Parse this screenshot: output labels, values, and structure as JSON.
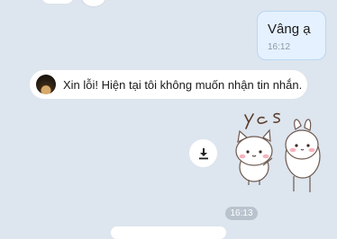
{
  "outgoing": {
    "text": "Vâng ạ",
    "time": "16:12"
  },
  "notice": {
    "text": "Xin lỗi! Hiện tại tôi không muốn nhận tin nhắn."
  },
  "sticker": {
    "caption": "yes",
    "icon": "bunny-cat-yes-sticker"
  },
  "download": {
    "icon": "download-icon"
  },
  "time_divider": "16:13"
}
